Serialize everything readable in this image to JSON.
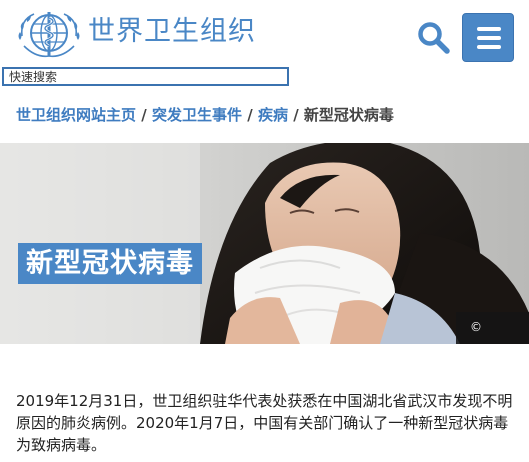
{
  "header": {
    "org_name": "世界卫生组织",
    "logo_icon": "who-emblem-icon",
    "search_icon": "search-icon",
    "menu_icon": "hamburger-menu-icon",
    "brand_color": "#4a87c6"
  },
  "search": {
    "placeholder": "快速搜索"
  },
  "breadcrumb": {
    "items": [
      "世卫组织网站主页",
      "突发卫生事件",
      "疾病"
    ],
    "separator": "/",
    "current": "新型冠状病毒"
  },
  "hero": {
    "title": "新型冠状病毒",
    "copyright": "©"
  },
  "article": {
    "paragraph": "2019年12月31日，世卫组织驻华代表处获悉在中国湖北省武汉市发现不明原因的肺炎病例。2020年1月7日，中国有关部门确认了一种新型冠状病毒为致病病毒。"
  }
}
